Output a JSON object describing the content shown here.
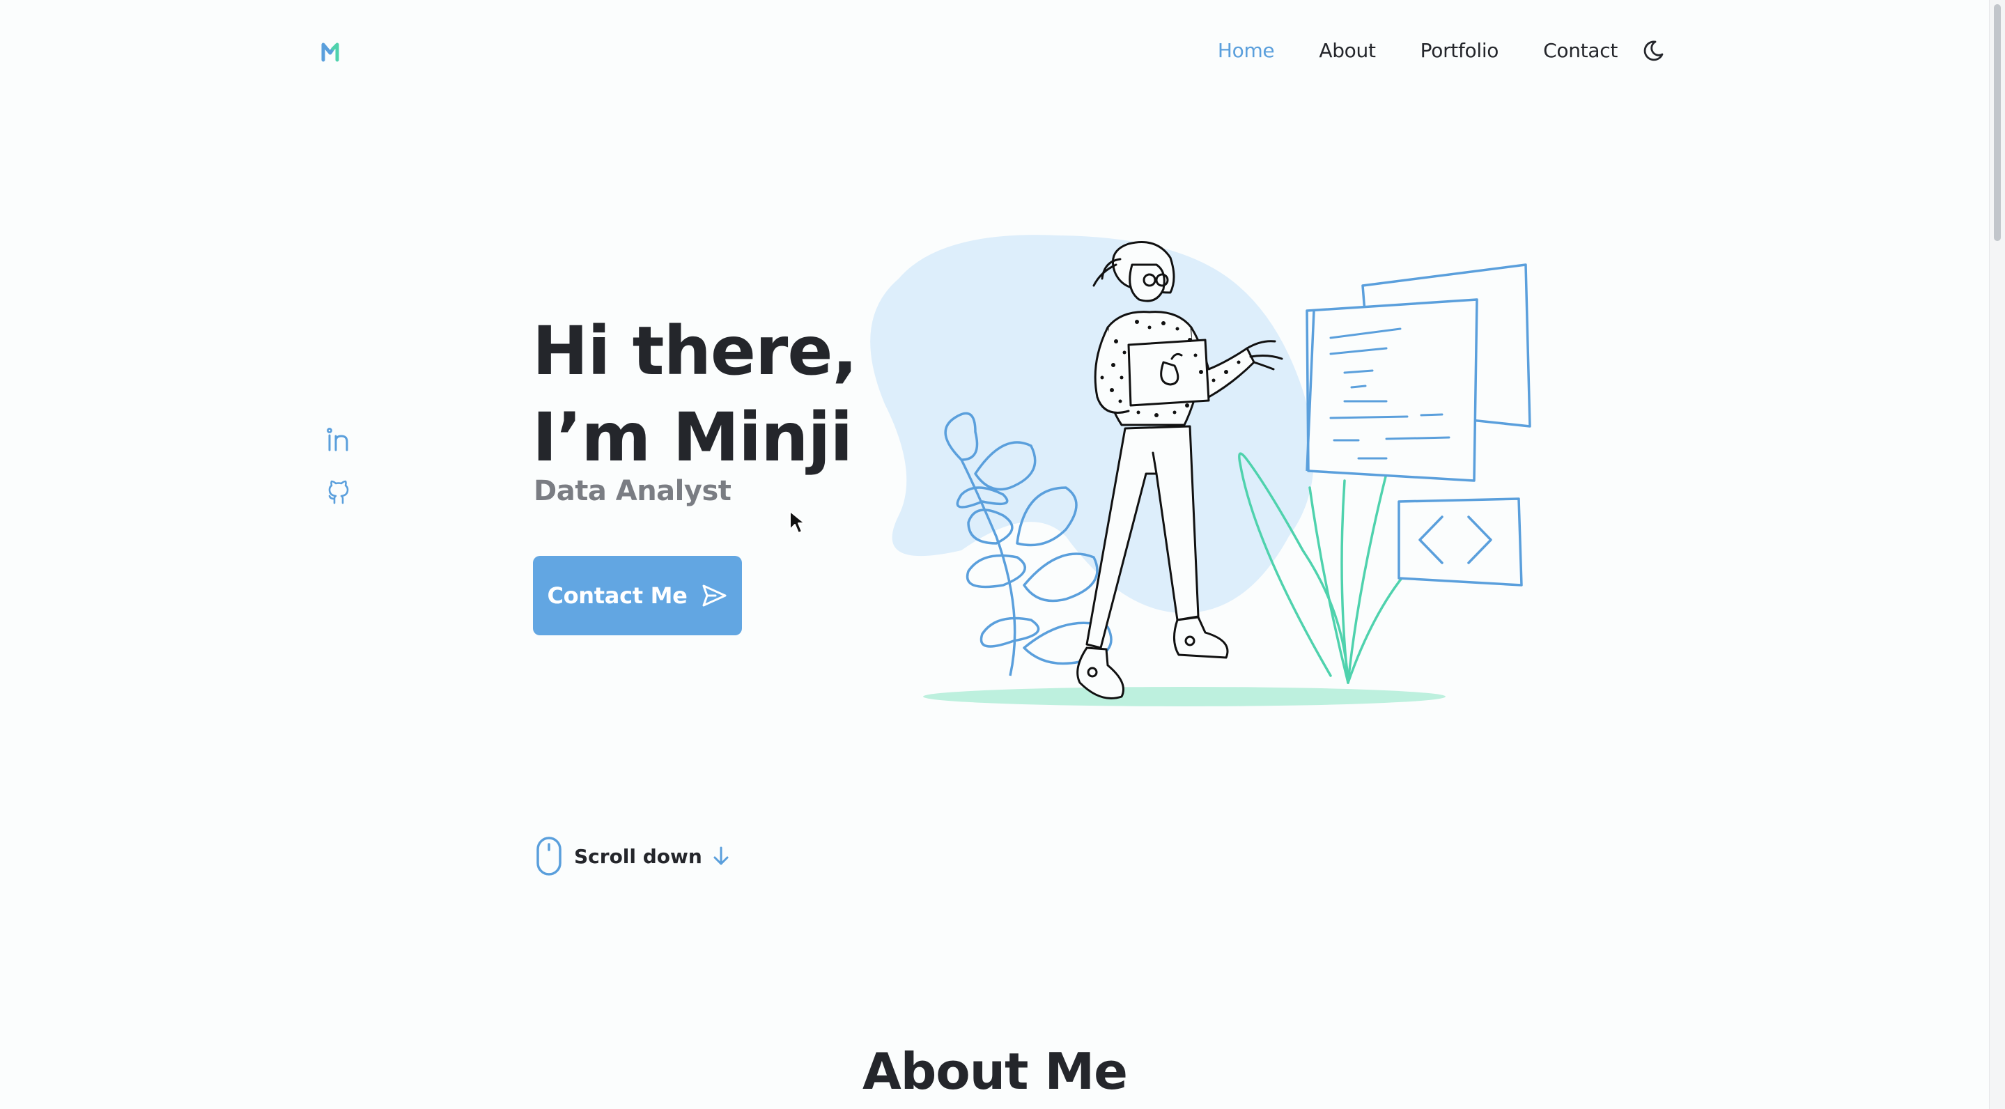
{
  "site": {
    "logo_letter": "M",
    "brand_colors": {
      "accent": "#5a9fdc",
      "accent_green": "#4fd2ad",
      "text": "#24262b",
      "muted": "#7a7d83",
      "button": "#62a6e2"
    }
  },
  "nav": {
    "items": [
      {
        "label": "Home",
        "active": true
      },
      {
        "label": "About",
        "active": false
      },
      {
        "label": "Portfolio",
        "active": false
      },
      {
        "label": "Contact",
        "active": false
      }
    ],
    "theme_icon": "moon-icon"
  },
  "socials": [
    {
      "icon": "linkedin-icon"
    },
    {
      "icon": "github-icon"
    }
  ],
  "hero": {
    "line1": "Hi there,",
    "line2": "I’m Minji",
    "subtitle": "Data Analyst",
    "cta_label": "Contact Me",
    "cta_icon": "send-icon"
  },
  "scroll": {
    "label": "Scroll down",
    "mouse_icon": "mouse-icon",
    "arrow_icon": "arrow-down-icon"
  },
  "about": {
    "heading": "About Me"
  }
}
